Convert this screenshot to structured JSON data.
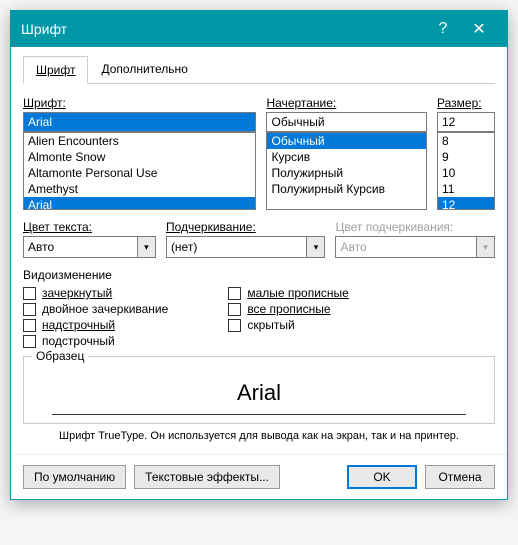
{
  "title": "Шрифт",
  "tabs": {
    "font": "Шрифт",
    "advanced": "Дополнительно"
  },
  "labels": {
    "font": "Шрифт:",
    "style": "Начертание:",
    "size": "Размер:",
    "color": "Цвет текста:",
    "underline": "Подчеркивание:",
    "underlineColor": "Цвет подчеркивания:",
    "effects": "Видоизменение",
    "preview": "Образец"
  },
  "font": {
    "value": "Arial",
    "items": [
      "Alien Encounters",
      "Almonte Snow",
      "Altamonte Personal Use",
      "Amethyst",
      "Arial"
    ],
    "selected": "Arial"
  },
  "style": {
    "value": "Обычный",
    "items": [
      "Обычный",
      "Курсив",
      "Полужирный",
      "Полужирный Курсив"
    ],
    "selected": "Обычный"
  },
  "size": {
    "value": "12",
    "items": [
      "8",
      "9",
      "10",
      "11",
      "12"
    ],
    "selected": "12"
  },
  "color": {
    "value": "Авто"
  },
  "underline": {
    "value": "(нет)"
  },
  "underlineColor": {
    "value": "Авто"
  },
  "checks": {
    "strike": "зачеркнутый",
    "dstrike": "двойное зачеркивание",
    "super": "надстрочный",
    "sub": "подстрочный",
    "smallcaps": "малые прописные",
    "allcaps": "все прописные",
    "hidden": "скрытый"
  },
  "preview": {
    "text": "Arial"
  },
  "desc": "Шрифт TrueType. Он используется для вывода как на экран, так и на принтер.",
  "buttons": {
    "default": "По умолчанию",
    "textfx": "Текстовые эффекты...",
    "ok": "OK",
    "cancel": "Отмена"
  }
}
